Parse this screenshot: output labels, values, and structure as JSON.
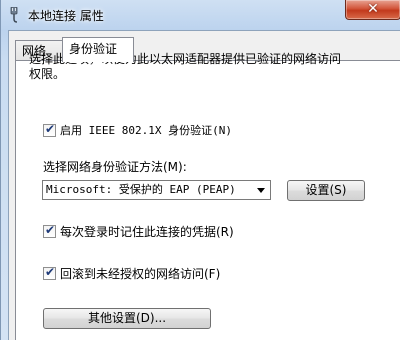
{
  "window": {
    "title": "本地连接 属性",
    "close_label": "✕"
  },
  "tabs": [
    {
      "label": "网络",
      "active": false
    },
    {
      "label": "身份验证",
      "active": true
    }
  ],
  "auth": {
    "description": "选择此选项，以便为此以太网适配器提供已验证的网络访问权限。",
    "enable_8021x": {
      "label": "启用 IEEE 802.1X 身份验证(N)",
      "checked": true
    },
    "method_label": "选择网络身份验证方法(M):",
    "method_select": {
      "value": "Microsoft: 受保护的 EAP (PEAP)"
    },
    "settings_button": "设置(S)",
    "remember_credentials": {
      "label": "每次登录时记住此连接的凭据(R)",
      "checked": true
    },
    "fallback_unauthorized": {
      "label": "回滚到未经授权的网络访问(F)",
      "checked": true
    },
    "other_settings_button": "其他设置(D)..."
  },
  "colors": {
    "close_button": "#c7462b",
    "title_gradient_top": "#cfe0f3",
    "panel_bg": "#ffffff"
  },
  "icons": {
    "app": "network-plug-icon",
    "tick": "checkmark-icon"
  }
}
